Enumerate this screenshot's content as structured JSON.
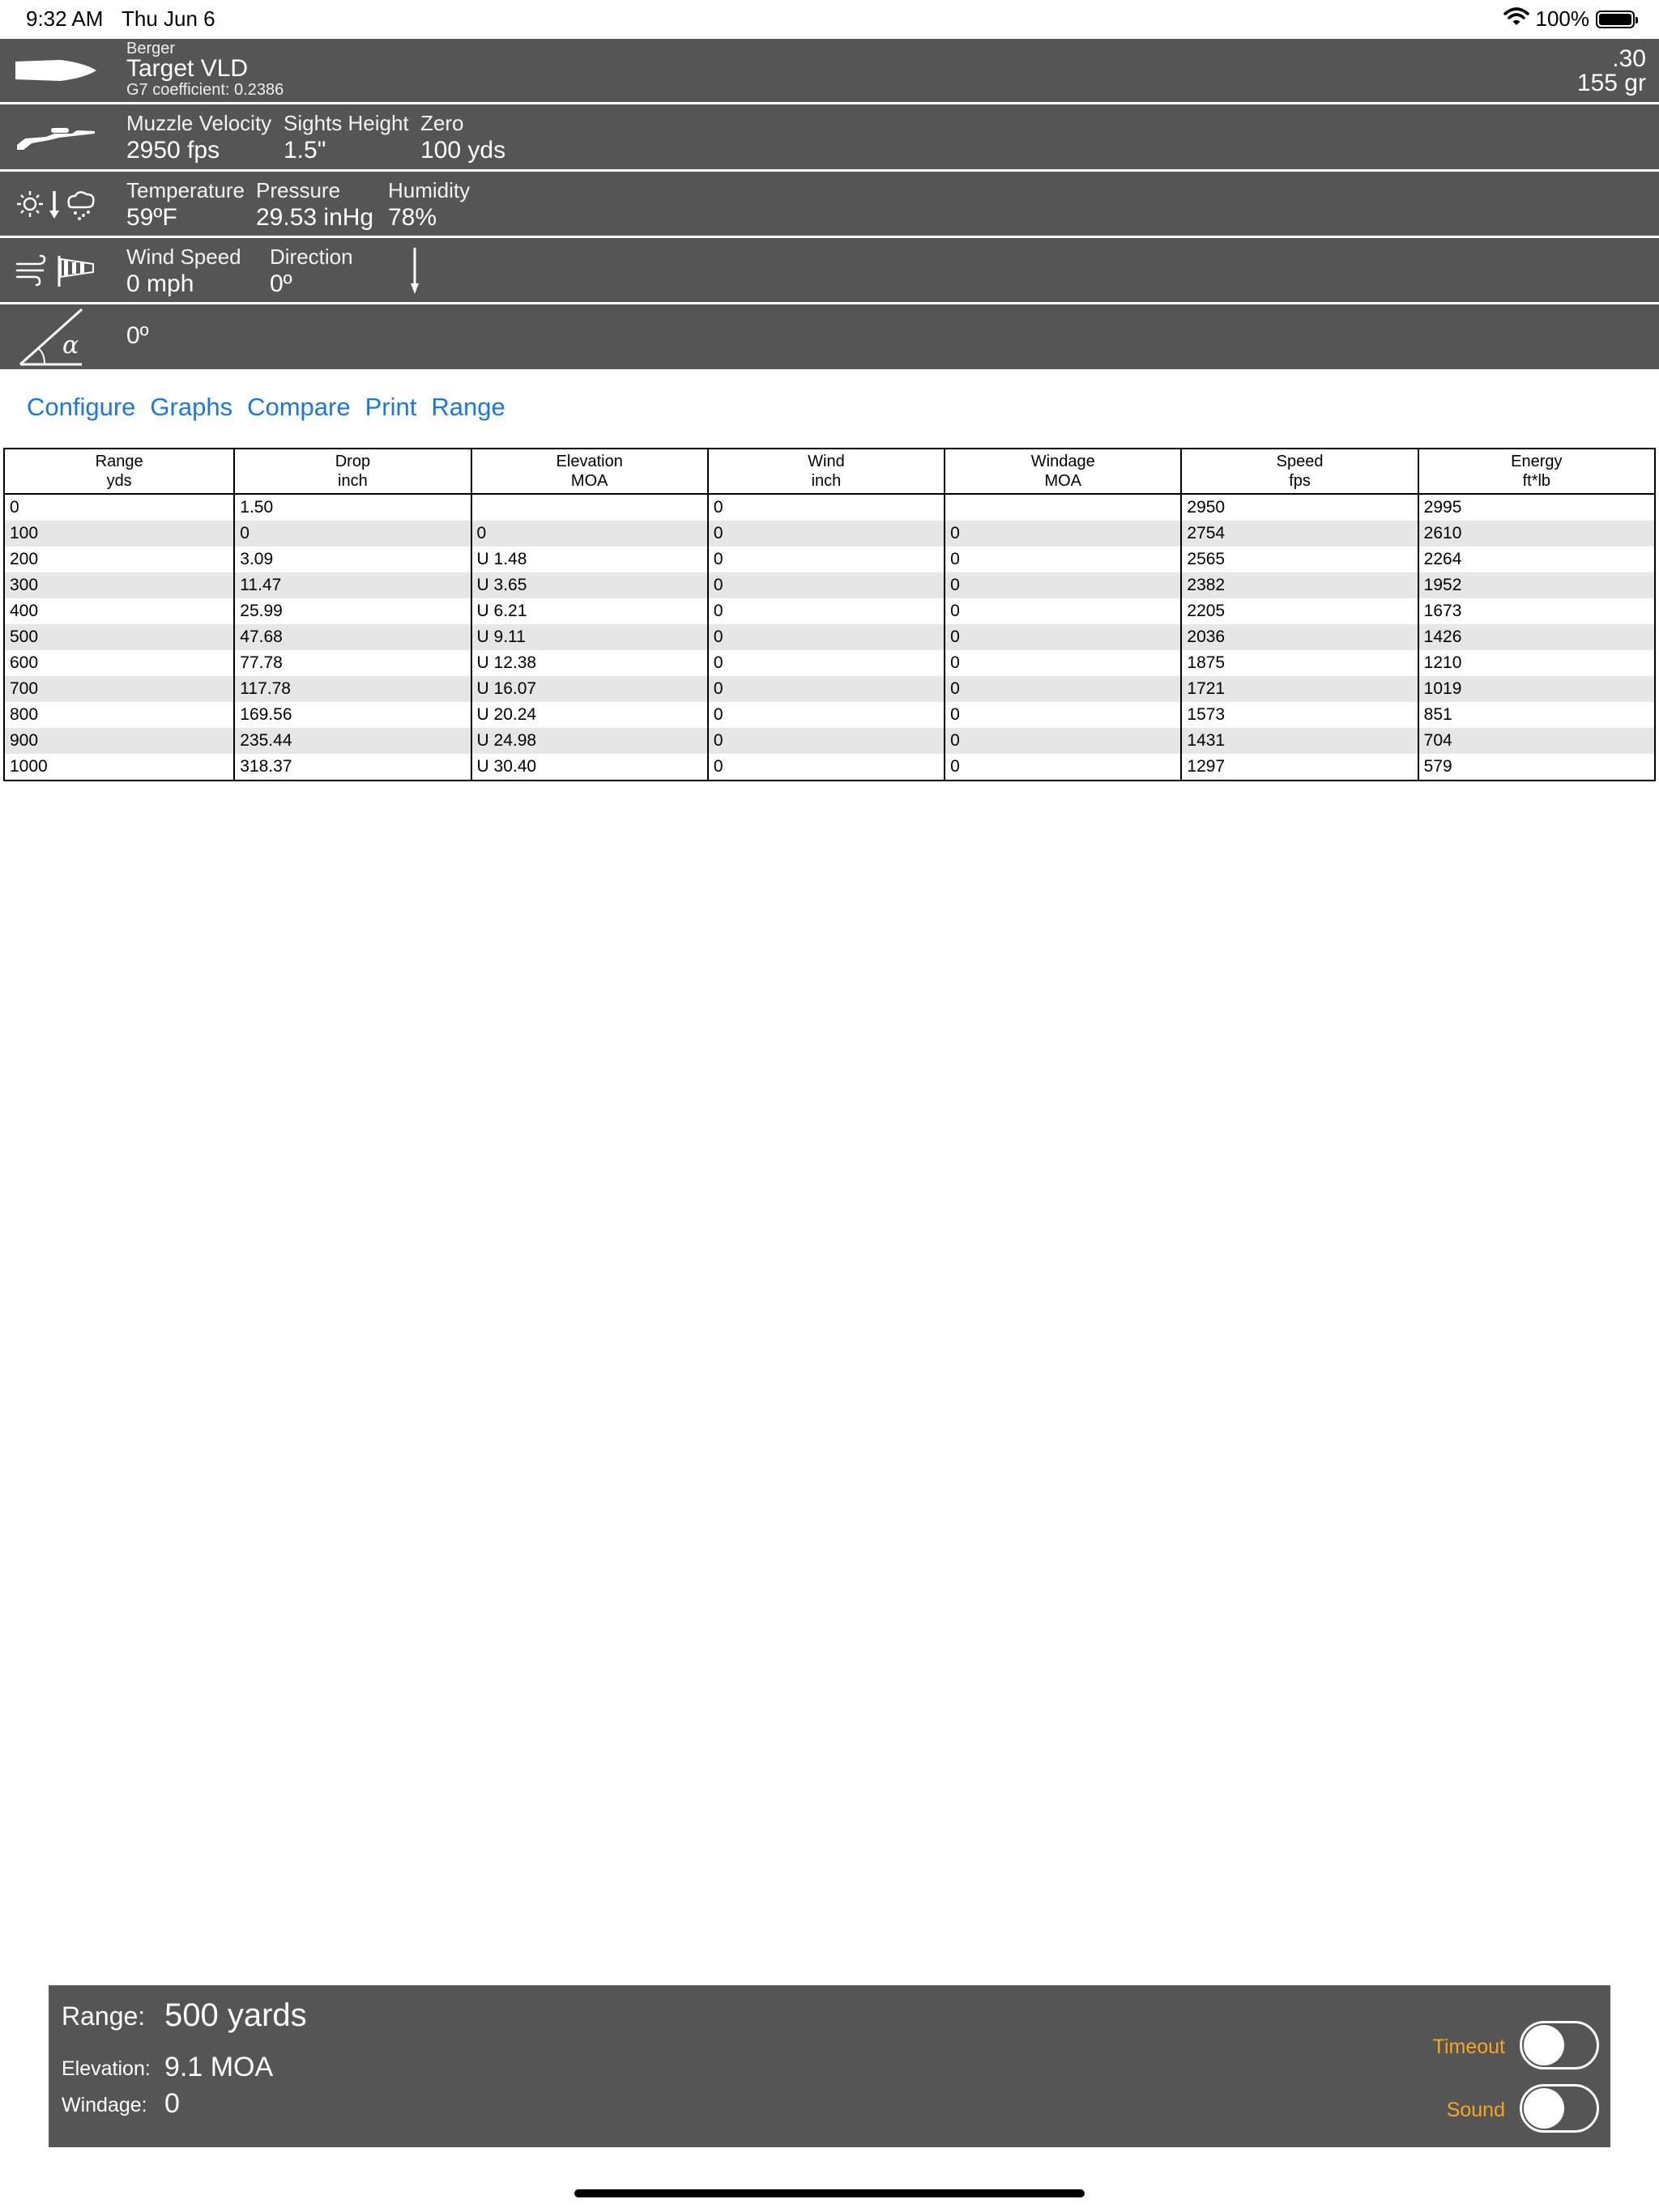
{
  "status_bar": {
    "time": "9:32 AM",
    "date": "Thu Jun 6",
    "battery": "100%",
    "battery_level": 1.0
  },
  "bullet": {
    "maker": "Berger",
    "name": "Target VLD",
    "coefficient": "G7 coefficient: 0.2386",
    "caliber": ".30",
    "weight": "155 gr"
  },
  "rifle": {
    "muzzle_velocity_label": "Muzzle Velocity",
    "muzzle_velocity": "2950 fps",
    "sights_height_label": "Sights Height",
    "sights_height": "1.5\"",
    "zero_label": "Zero",
    "zero": "100 yds"
  },
  "atmosphere": {
    "temperature_label": "Temperature",
    "temperature": "59ºF",
    "pressure_label": "Pressure",
    "pressure": "29.53 inHg",
    "humidity_label": "Humidity",
    "humidity": "78%"
  },
  "wind": {
    "speed_label": "Wind Speed",
    "speed": "0 mph",
    "direction_label": "Direction",
    "direction": "0º"
  },
  "angle": {
    "icon_letter": "α",
    "value": "0º"
  },
  "links": [
    "Configure",
    "Graphs",
    "Compare",
    "Print",
    "Range"
  ],
  "table": {
    "headers": [
      {
        "name": "Range",
        "unit": "yds"
      },
      {
        "name": "Drop",
        "unit": "inch"
      },
      {
        "name": "Elevation",
        "unit": "MOA"
      },
      {
        "name": "Wind",
        "unit": "inch"
      },
      {
        "name": "Windage",
        "unit": "MOA"
      },
      {
        "name": "Speed",
        "unit": "fps"
      },
      {
        "name": "Energy",
        "unit": "ft*lb"
      }
    ],
    "rows": [
      [
        "0",
        "1.50",
        "",
        "0",
        "",
        "2950",
        "2995"
      ],
      [
        "100",
        "0",
        "0",
        "0",
        "0",
        "2754",
        "2610"
      ],
      [
        "200",
        "3.09",
        "U 1.48",
        "0",
        "0",
        "2565",
        "2264"
      ],
      [
        "300",
        "11.47",
        "U 3.65",
        "0",
        "0",
        "2382",
        "1952"
      ],
      [
        "400",
        "25.99",
        "U 6.21",
        "0",
        "0",
        "2205",
        "1673"
      ],
      [
        "500",
        "47.68",
        "U 9.11",
        "0",
        "0",
        "2036",
        "1426"
      ],
      [
        "600",
        "77.78",
        "U 12.38",
        "0",
        "0",
        "1875",
        "1210"
      ],
      [
        "700",
        "117.78",
        "U 16.07",
        "0",
        "0",
        "1721",
        "1019"
      ],
      [
        "800",
        "169.56",
        "U 20.24",
        "0",
        "0",
        "1573",
        "851"
      ],
      [
        "900",
        "235.44",
        "U 24.98",
        "0",
        "0",
        "1431",
        "704"
      ],
      [
        "1000",
        "318.37",
        "U 30.40",
        "0",
        "0",
        "1297",
        "579"
      ]
    ]
  },
  "panel": {
    "range_label": "Range:",
    "range_value": "500 yards",
    "elevation_label": "Elevation:",
    "elevation_value": "9.1 MOA",
    "windage_label": "Windage:",
    "windage_value": "0",
    "timeout_label": "Timeout",
    "sound_label": "Sound",
    "timeout_on": false,
    "sound_on": false
  },
  "colors": {
    "header_bg": "#555555",
    "link": "#1a78e6",
    "toggle_label": "#f5a623",
    "alt_row": "#e6e6e6"
  }
}
